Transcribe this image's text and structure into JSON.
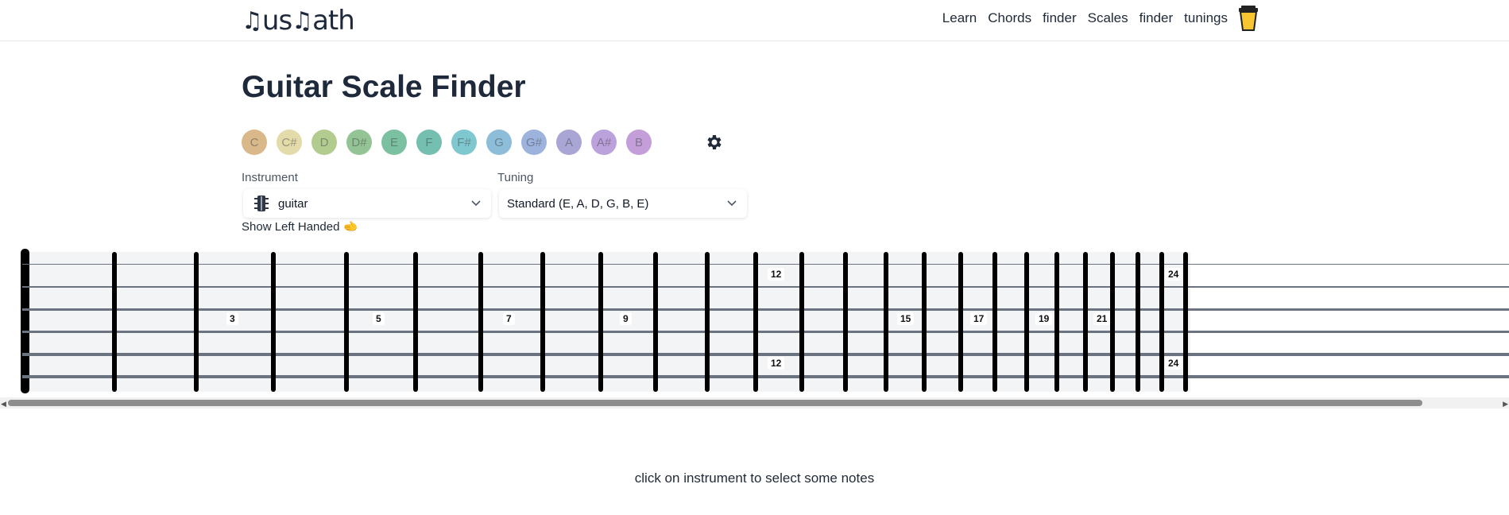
{
  "header": {
    "logo": "MusMath",
    "nav": [
      "Learn",
      "Chords",
      "finder",
      "Scales",
      "finder",
      "tunings"
    ]
  },
  "page": {
    "title": "Guitar Scale Finder",
    "hint": "click on instrument to select some notes"
  },
  "notes": [
    {
      "label": "C",
      "color": "#d9b98a"
    },
    {
      "label": "C#",
      "color": "#e3dbaa"
    },
    {
      "label": "D",
      "color": "#b2cc8f"
    },
    {
      "label": "D#",
      "color": "#94c496"
    },
    {
      "label": "E",
      "color": "#7cc0a2"
    },
    {
      "label": "F",
      "color": "#75bfb0"
    },
    {
      "label": "F#",
      "color": "#80c8cf"
    },
    {
      "label": "G",
      "color": "#8dbdd8"
    },
    {
      "label": "G#",
      "color": "#9db3de"
    },
    {
      "label": "A",
      "color": "#a9a6d6"
    },
    {
      "label": "A#",
      "color": "#bba2dc"
    },
    {
      "label": "B",
      "color": "#c39ed9"
    }
  ],
  "instrument": {
    "label": "Instrument",
    "value": "guitar"
  },
  "tuning": {
    "label": "Tuning",
    "value": "Standard (E, A, D, G, B, E)"
  },
  "options": {
    "left_handed": "Show Left Handed 🫲"
  },
  "fretboard": {
    "markers_single": [
      "3",
      "5",
      "7",
      "9",
      "15",
      "17",
      "19",
      "21"
    ],
    "markers_double": [
      "12",
      "24"
    ]
  }
}
